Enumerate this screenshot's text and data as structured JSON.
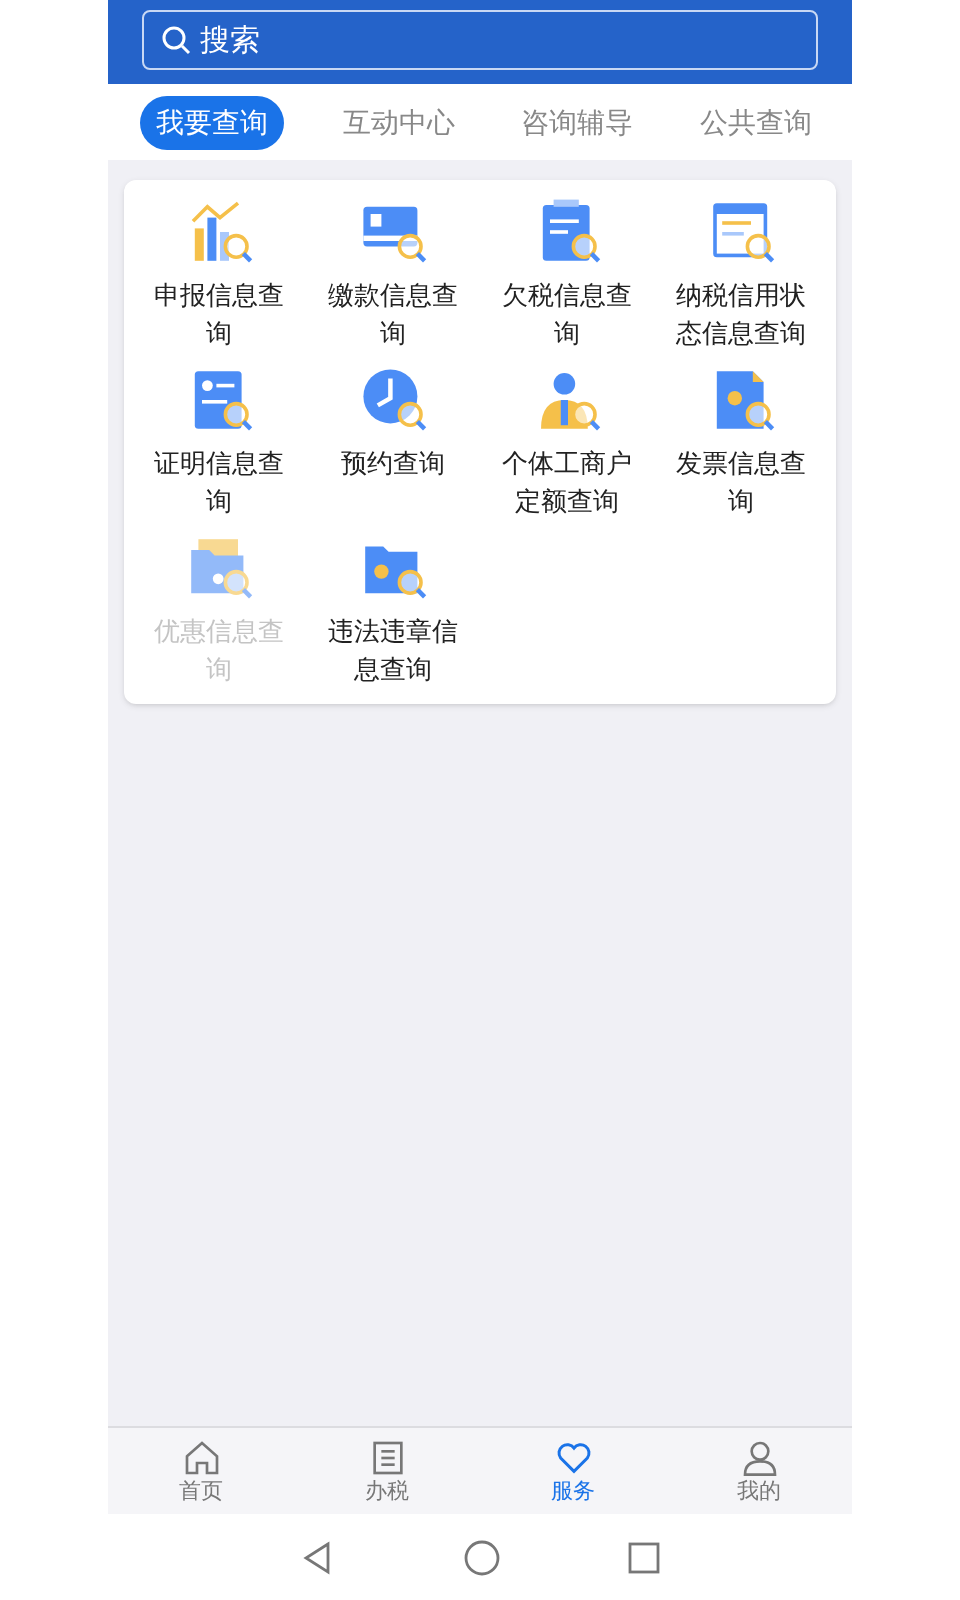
{
  "search": {
    "placeholder": "搜索"
  },
  "tabs": [
    {
      "label": "我要查询",
      "selected": true
    },
    {
      "label": "互动中心",
      "selected": false
    },
    {
      "label": "咨询辅导",
      "selected": false
    },
    {
      "label": "公共查询",
      "selected": false
    }
  ],
  "services": [
    {
      "label": "申报信息查询",
      "disabled": false
    },
    {
      "label": "缴款信息查询",
      "disabled": false
    },
    {
      "label": "欠税信息查询",
      "disabled": false
    },
    {
      "label": "纳税信用状态信息查询",
      "disabled": false
    },
    {
      "label": "证明信息查询",
      "disabled": false
    },
    {
      "label": "预约查询",
      "disabled": false
    },
    {
      "label": "个体工商户定额查询",
      "disabled": false
    },
    {
      "label": "发票信息查询",
      "disabled": false
    },
    {
      "label": "优惠信息查询",
      "disabled": true
    },
    {
      "label": "违法违章信息查询",
      "disabled": false
    }
  ],
  "bottom_nav": [
    {
      "label": "首页",
      "selected": false
    },
    {
      "label": "办税",
      "selected": false
    },
    {
      "label": "服务",
      "selected": true
    },
    {
      "label": "我的",
      "selected": false
    }
  ]
}
